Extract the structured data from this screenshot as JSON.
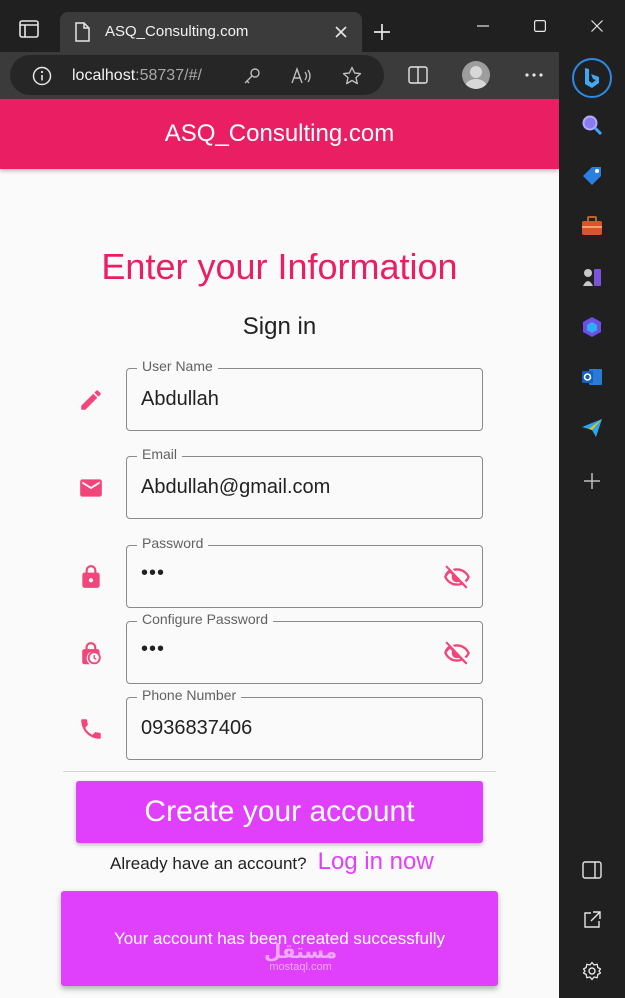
{
  "browser": {
    "tab_title": "ASQ_Consulting.com",
    "url_host": "localhost",
    "url_rest": ":58737/#/",
    "icons": {
      "tab_actions": "tab-actions-icon",
      "new_tab": "plus-icon",
      "minimize": "minimize-icon",
      "maximize": "maximize-icon",
      "close": "close-icon",
      "site_info": "info-icon",
      "key": "key-icon",
      "read_aloud": "read-aloud-icon",
      "favorite": "star-icon",
      "split_screen": "split-screen-icon",
      "profile": "avatar",
      "more": "more-icon"
    }
  },
  "edge_sidebar": {
    "items": [
      "bing-copilot",
      "search",
      "shopping",
      "tools",
      "games",
      "microsoft-365",
      "outlook",
      "send",
      "add",
      "hide-sidebar",
      "open-external",
      "settings"
    ]
  },
  "app": {
    "title": "ASQ_Consulting.com",
    "heading": "Enter your Information",
    "subheading": "Sign in",
    "fields": {
      "username": {
        "label": "User Name",
        "value": "Abdullah"
      },
      "email": {
        "label": "Email",
        "value": "Abdullah@gmail.com"
      },
      "password": {
        "label": "Password",
        "value": "•••"
      },
      "confirm": {
        "label": "Configure Password",
        "value": "•••"
      },
      "phone": {
        "label": "Phone Number",
        "value": "0936837406"
      }
    },
    "create_button": "Create your account",
    "login_question": "Already have an account?",
    "login_link": "Log in now",
    "snackbar": "Your account has been created successfully",
    "watermark_arabic": "مستقل",
    "watermark_latin": "mostaql.com",
    "colors": {
      "appbar": "#e91e63",
      "heading": "#e91e63",
      "accent": "#e040fb",
      "icon": "#f2457a"
    }
  }
}
